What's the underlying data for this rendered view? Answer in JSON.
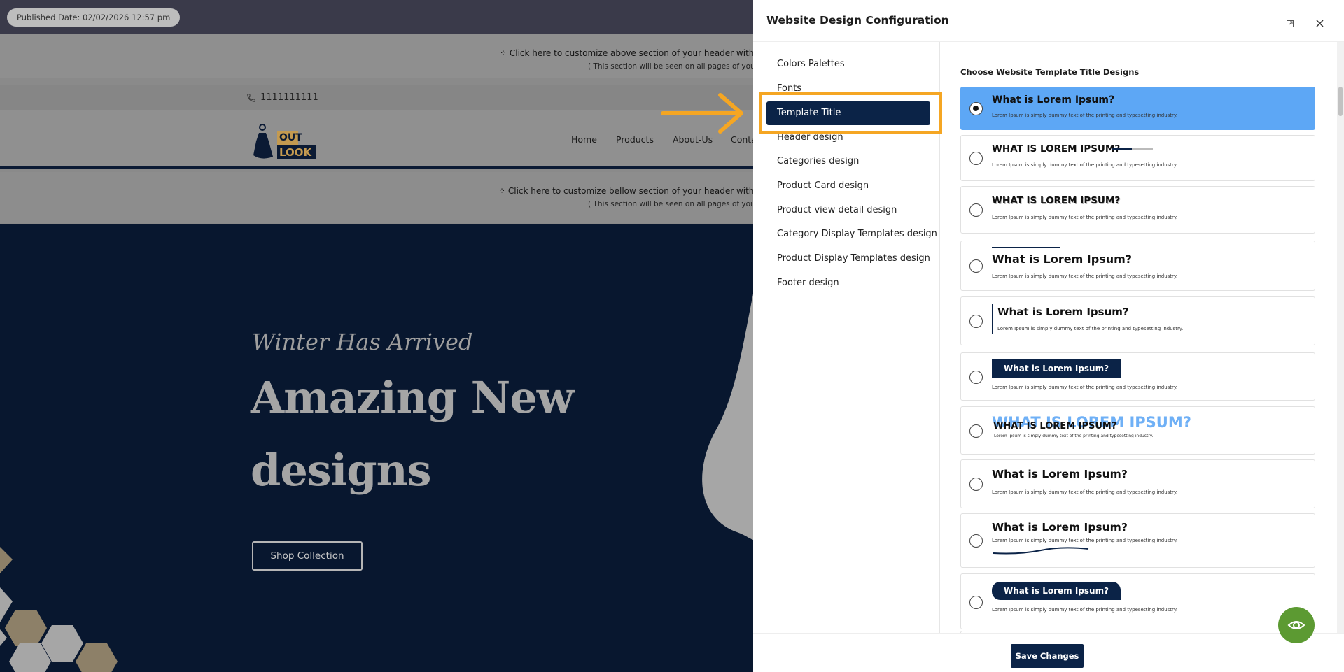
{
  "site": {
    "published": "Published Date: 02/02/2026 12:57 pm",
    "header_top_text": "⁘ Click here to customize above section of your header with our po",
    "header_top_sub": "( This section will be seen on all pages of your store",
    "phone": "1111111111",
    "logo_text_1": "OUT",
    "logo_text_2": "LOOK",
    "nav": [
      "Home",
      "Products",
      "About-Us",
      "Conta"
    ],
    "header_bottom_text": "⁘ Click here to customize bellow section of your header with our po",
    "header_bottom_sub": "( This section will be seen on all pages of your store",
    "hero_script": "Winter Has Arrived",
    "hero_title_1": "Amazing New",
    "hero_title_2": "designs",
    "shop_button": "Shop Collection"
  },
  "modal": {
    "title": "Website Design Configuration",
    "menu": [
      "Colors Palettes",
      "Fonts",
      "Template Title",
      "Header design",
      "Categories design",
      "Product Card design",
      "Product view detail design",
      "Category Display Templates design",
      "Product Display Templates design",
      "Footer design"
    ],
    "active_menu": "Template Title",
    "content_title": "Choose Website Template Title Designs",
    "options": [
      {
        "title": "What is Lorem Ipsum?",
        "desc": "Lorem Ipsum is simply dummy text of the printing and typesetting industry.",
        "selected": true
      },
      {
        "title": "WHAT IS LOREM IPSUM?",
        "desc": "Lorem Ipsum is simply dummy text of the printing and typesetting industry."
      },
      {
        "title": "WHAT IS LOREM IPSUM?",
        "desc": "Lorem Ipsum is simply dummy text of the printing and typesetting industry."
      },
      {
        "title": "What is Lorem Ipsum?",
        "desc": "Lorem Ipsum is simply dummy text of the printing and typesetting industry."
      },
      {
        "title": "What is Lorem Ipsum?",
        "desc": "Lorem Ipsum is simply dummy text of the printing and typesetting industry."
      },
      {
        "title": "What is Lorem Ipsum?",
        "desc": "Lorem Ipsum is simply dummy text of the printing and typesetting industry."
      },
      {
        "title": "WHAT IS LOREM IPSUM?",
        "title_back": "WHAT IS LOREM IPSUM?",
        "desc": "Lorem Ipsum is simply dummy text of the printing and typesetting industry."
      },
      {
        "title": "What is Lorem Ipsum?",
        "desc": "Lorem Ipsum is simply dummy text of the printing and typesetting industry."
      },
      {
        "title": "What is Lorem Ipsum?",
        "desc": "Lorem Ipsum is simply dummy text of the printing and typesetting industry."
      },
      {
        "title": "What is Lorem Ipsum?",
        "desc": "Lorem Ipsum is simply dummy text of the printing and typesetting industry."
      }
    ],
    "save_label": "Save Changes"
  },
  "icons": {
    "phone": "phone-icon",
    "expand": "expand-icon",
    "close": "close-icon",
    "preview": "eye-icon",
    "annotation": "arrow-right-icon"
  },
  "colors": {
    "navy": "#0b2347",
    "selected_option": "#5da7f5",
    "highlight": "#f5a623",
    "preview_button": "#5c9a32"
  }
}
